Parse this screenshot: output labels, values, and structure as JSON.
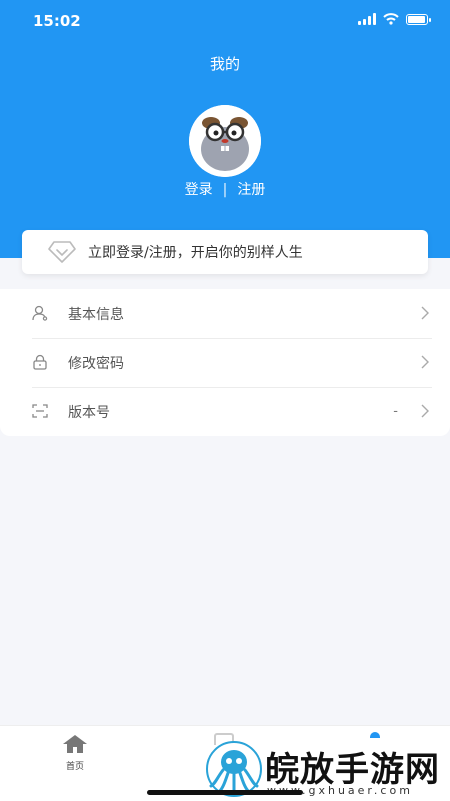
{
  "status_bar": {
    "time": "15:02"
  },
  "header": {
    "title": "我的",
    "login_label": "登录",
    "separator": "|",
    "register_label": "注册"
  },
  "banner": {
    "text": "立即登录/注册，开启你的别样人生"
  },
  "menu": {
    "items": [
      {
        "label": "基本信息",
        "icon": "user-icon"
      },
      {
        "label": "修改密码",
        "icon": "lock-icon"
      },
      {
        "label": "版本号",
        "icon": "scan-frame-icon",
        "value": "-"
      }
    ]
  },
  "tabbar": {
    "home_label": "首页"
  },
  "watermark": {
    "text": "皖放手游网",
    "url": "www.gxhuaer.com"
  },
  "colors": {
    "primary": "#2196f3",
    "background": "#f5f6fa"
  }
}
